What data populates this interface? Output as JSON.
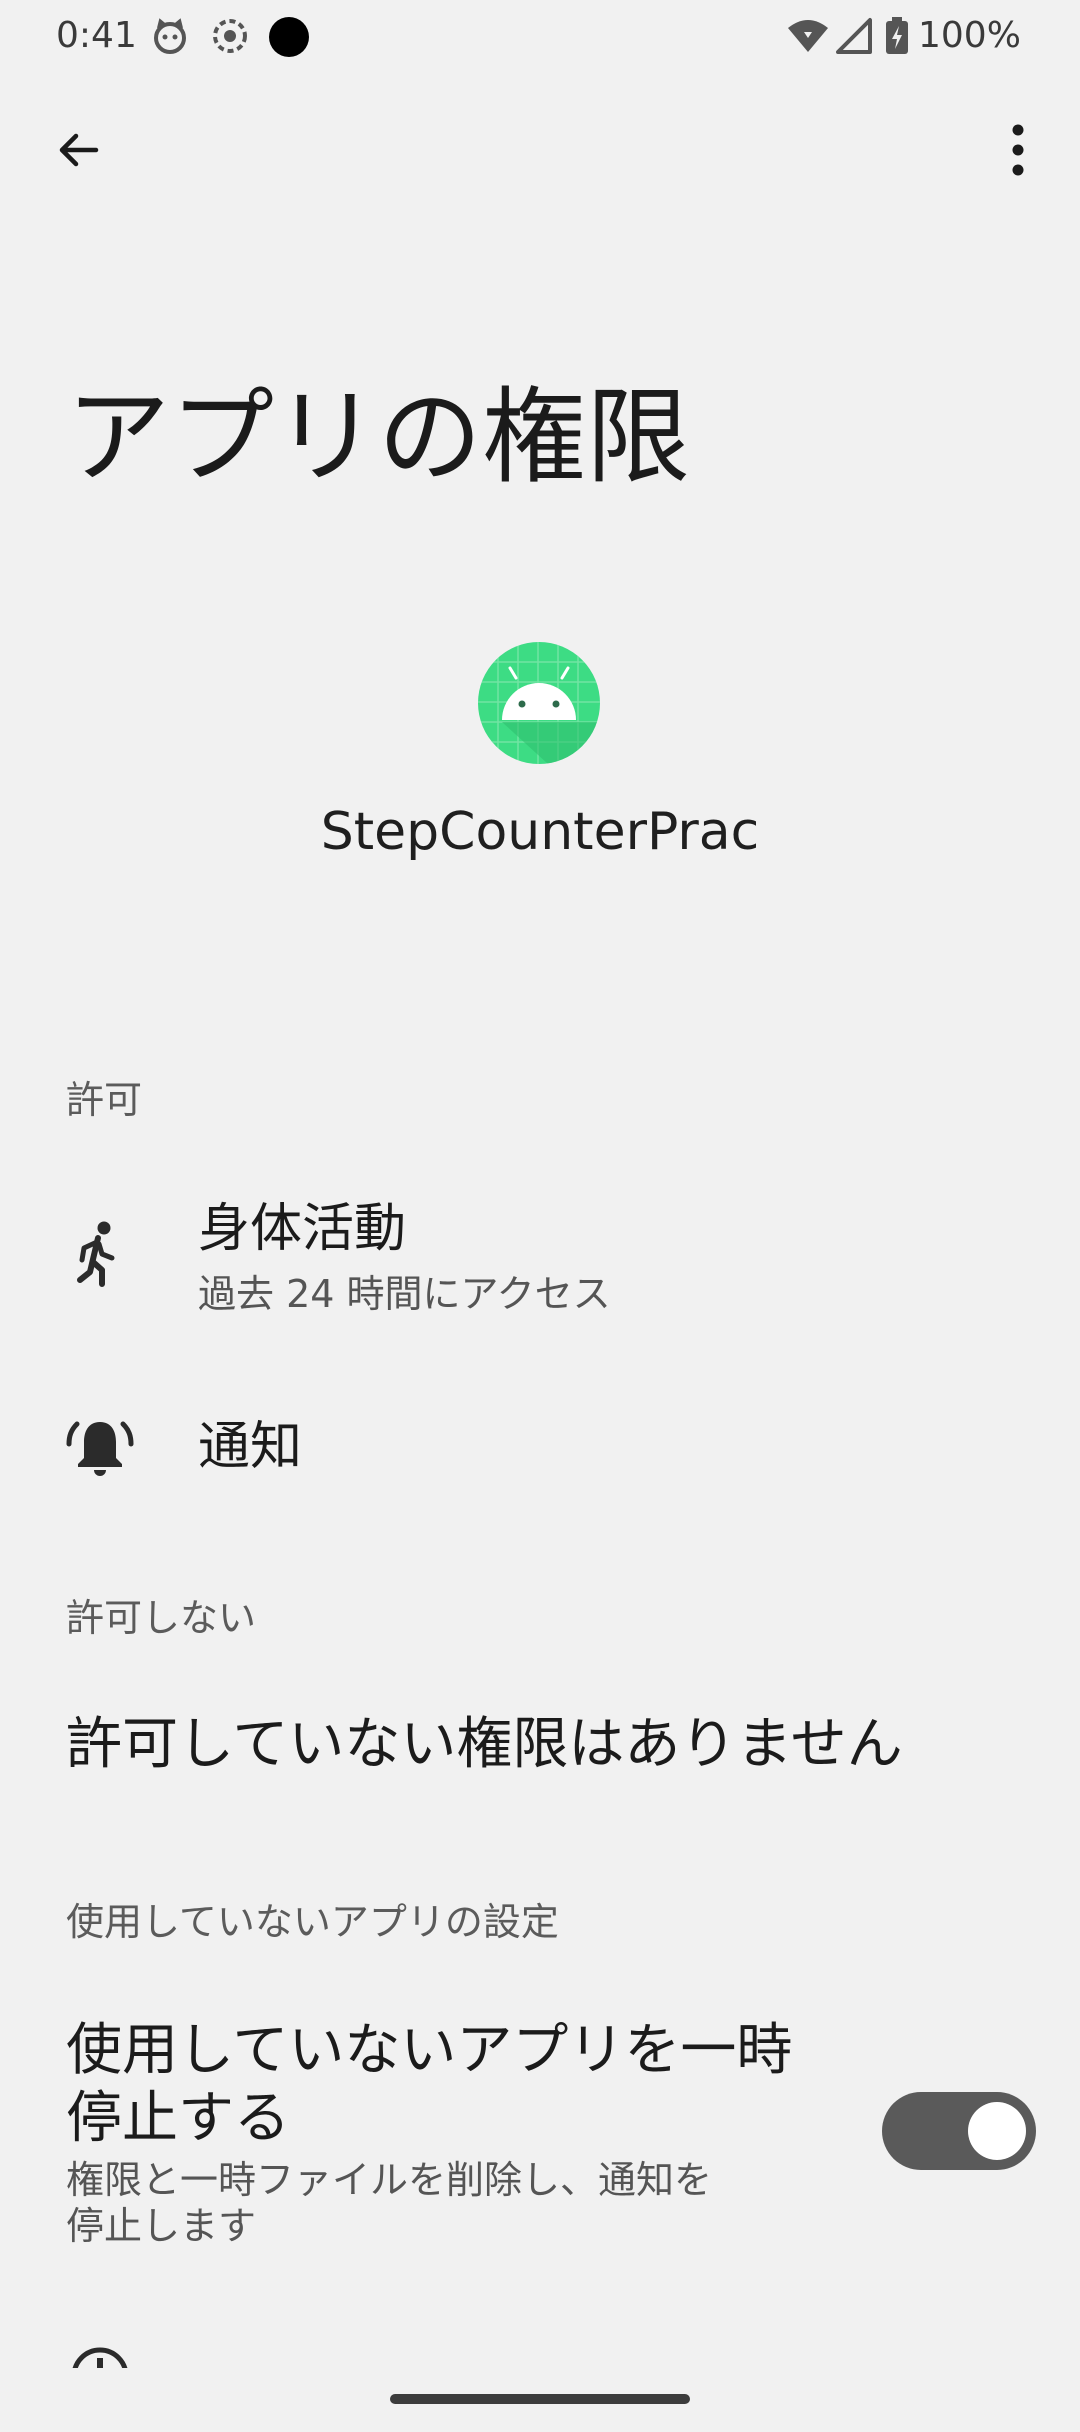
{
  "status_bar": {
    "time": "0:41",
    "battery": "100%"
  },
  "page": {
    "title": "アプリの権限"
  },
  "app": {
    "name": "StepCounterPrac",
    "icon": "android-icon",
    "icon_color": "#3ddc84"
  },
  "sections": {
    "allowed_header": "許可",
    "denied_header": "許可しない",
    "unused_header": "使用していないアプリの設定"
  },
  "permissions": {
    "activity_title": "身体活動",
    "activity_sub": "過去 24 時間にアクセス",
    "notification_title": "通知"
  },
  "denied": {
    "empty_text": "許可していない権限はありません"
  },
  "unused_setting": {
    "title_line1": "使用していないアプリを一時",
    "title_line2": "停止する",
    "desc_line1": "権限と一時ファイルを削除し、通知を",
    "desc_line2": "停止します",
    "toggle_on": true
  },
  "colors": {
    "background": "#f1f1f1",
    "toggle_track": "#5a5a5a"
  }
}
